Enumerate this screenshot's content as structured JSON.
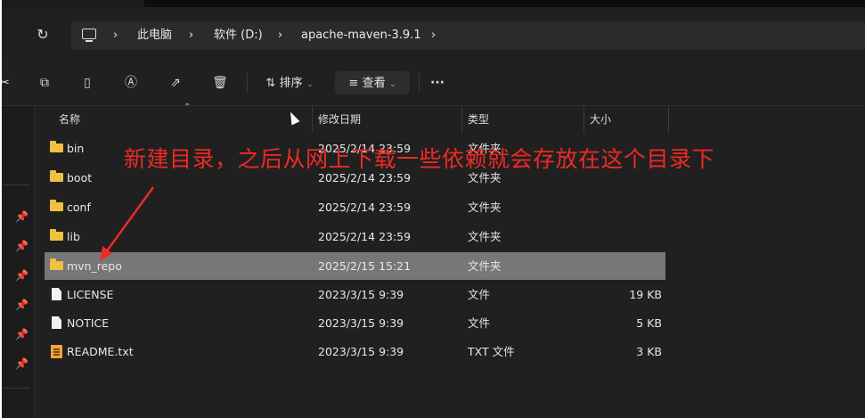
{
  "address_bar": {
    "refresh_icon": "refresh-icon",
    "crumbs": [
      "此电脑",
      "软件 (D:)",
      "apache-maven-3.9.1"
    ],
    "separator": "›"
  },
  "toolbar": {
    "sort_label": "排序",
    "view_label": "查看",
    "more_label": "···",
    "icons": [
      "cut-icon",
      "copy-icon",
      "paste-icon",
      "rename-icon",
      "share-icon",
      "delete-icon"
    ]
  },
  "columns": {
    "name": "名称",
    "date": "修改日期",
    "type": "类型",
    "size": "大小"
  },
  "files": [
    {
      "name": "bin",
      "date": "2025/2/14 23:59",
      "type": "文件夹",
      "size": "",
      "kind": "folder",
      "selected": false
    },
    {
      "name": "boot",
      "date": "2025/2/14 23:59",
      "type": "文件夹",
      "size": "",
      "kind": "folder",
      "selected": false
    },
    {
      "name": "conf",
      "date": "2025/2/14 23:59",
      "type": "文件夹",
      "size": "",
      "kind": "folder",
      "selected": false
    },
    {
      "name": "lib",
      "date": "2025/2/14 23:59",
      "type": "文件夹",
      "size": "",
      "kind": "folder",
      "selected": false
    },
    {
      "name": "mvn_repo",
      "date": "2025/2/15 15:21",
      "type": "文件夹",
      "size": "",
      "kind": "folder",
      "selected": true
    },
    {
      "name": "LICENSE",
      "date": "2023/3/15 9:39",
      "type": "文件",
      "size": "19 KB",
      "kind": "file",
      "selected": false
    },
    {
      "name": "NOTICE",
      "date": "2023/3/15 9:39",
      "type": "文件",
      "size": "5 KB",
      "kind": "file",
      "selected": false
    },
    {
      "name": "README.txt",
      "date": "2023/3/15 9:39",
      "type": "TXT 文件",
      "size": "3 KB",
      "kind": "txt",
      "selected": false
    }
  ],
  "annotation": {
    "text": "新建目录，之后从网上下载一些依赖就会存放在这个目录下",
    "color": "#ee2a24"
  },
  "colors": {
    "background": "#202020",
    "selected_row": "#777777",
    "folder": "#f0c040"
  }
}
